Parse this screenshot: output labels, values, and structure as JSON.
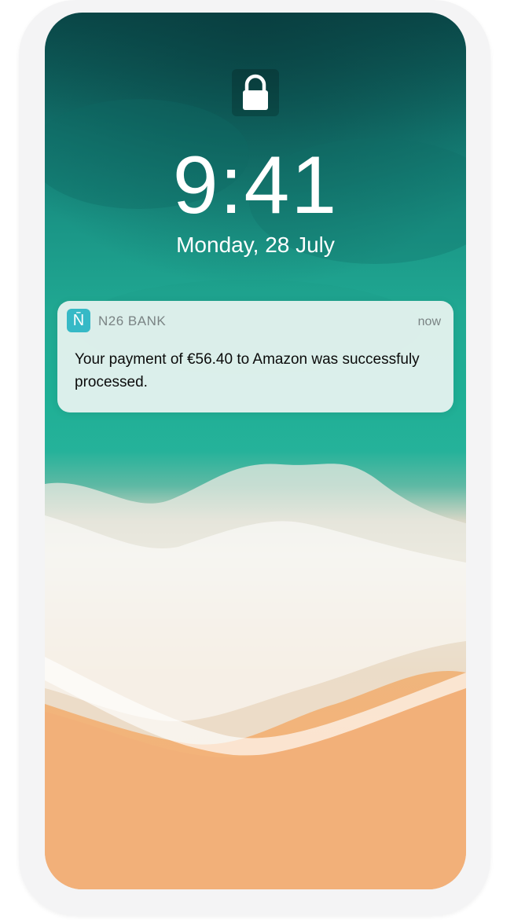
{
  "lock_screen": {
    "time": "9:41",
    "date": "Monday, 28 July"
  },
  "notification": {
    "app_icon_glyph": "N̄",
    "app_name": "N26 BANK",
    "time": "now",
    "message": "Your payment of €56.40 to Amazon was successfuly processed."
  },
  "colors": {
    "app_icon_bg": "#36b9c6",
    "ocean": "#1faf95",
    "sand": "#f2b079"
  },
  "icons": {
    "lock": "lock-icon",
    "app": "n26-app-icon"
  }
}
